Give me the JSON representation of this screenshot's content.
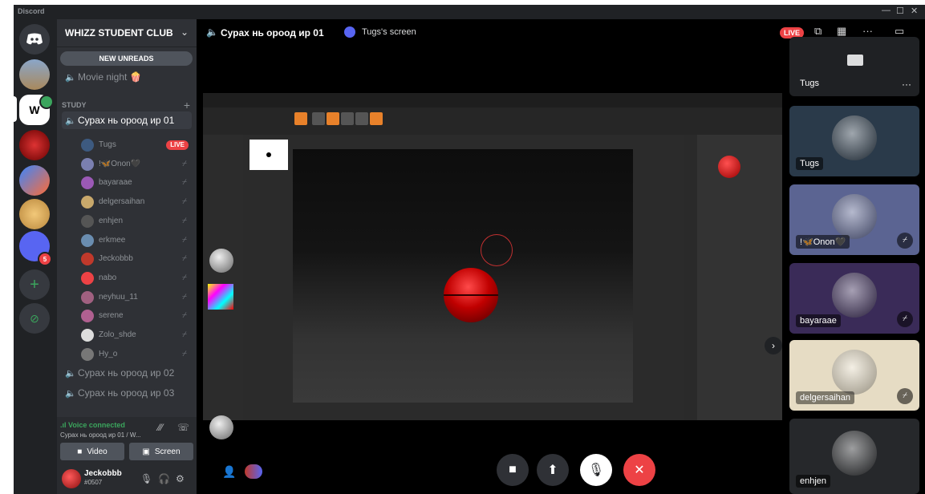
{
  "window": {
    "app_name": "Discord",
    "minimize": "—",
    "maximize": "☐",
    "close": "✕"
  },
  "servers": [
    {
      "name": "discord-home",
      "label": "🎮"
    },
    {
      "name": "server-temple",
      "label": ""
    },
    {
      "name": "server-whizz",
      "label": "W",
      "badge": ""
    },
    {
      "name": "server-demon",
      "label": ""
    },
    {
      "name": "server-unity",
      "label": "",
      "badge": ""
    },
    {
      "name": "server-doge",
      "label": ""
    },
    {
      "name": "server-folder",
      "label": "",
      "badge": "5"
    }
  ],
  "server_header": {
    "name": "WHIZZ STUDENT CLUB"
  },
  "sidebar": {
    "new_unreads": "NEW UNREADS",
    "movie_night": "Movie night 🍿",
    "category": "STUDY",
    "active_channel": "Сурах нь ороод ир 01",
    "voice_users": [
      {
        "name": "Tugs",
        "live": "LIVE",
        "color": "#3d5a80"
      },
      {
        "name": "!🦋Onon🖤",
        "color": "#7a7fb0"
      },
      {
        "name": "bayaraae",
        "color": "#9b59b6"
      },
      {
        "name": "delgersaihan",
        "color": "#c8a86b"
      },
      {
        "name": "enhjen",
        "color": "#555"
      },
      {
        "name": "erkmee",
        "color": "#6a8db0"
      },
      {
        "name": "Jeckobbb",
        "color": "#c0392b"
      },
      {
        "name": "nabo",
        "color": "#ed4245"
      },
      {
        "name": "neyhuu_11",
        "color": "#a06080"
      },
      {
        "name": "serene",
        "color": "#b06090"
      },
      {
        "name": "Zolo_shde",
        "color": "#ddd"
      },
      {
        "name": "Hy_o",
        "color": "#777"
      }
    ],
    "other_channels": [
      "Сурах нь ороод ир 02",
      "Сурах нь ороод ир 03"
    ]
  },
  "voice_panel": {
    "status": ".ıl Voice connected",
    "channel": "Сурах нь ороод ир 01 / W...",
    "video_label": "Video",
    "screen_label": "Screen"
  },
  "user_panel": {
    "username": "Jeckobbb",
    "tag": "#0507"
  },
  "topbar": {
    "channel": "Сурах нь ороод ир 01",
    "screen": "Tugs's screen",
    "live": "LIVE",
    "more": "···"
  },
  "tiles": [
    {
      "name": "Tugs",
      "muted": false,
      "bg": "#1f2124"
    },
    {
      "name": "Tugs",
      "muted": false,
      "bg": "#2a3a4a"
    },
    {
      "name": "!🦋Onon🖤",
      "muted": true,
      "bg": "#5b6492"
    },
    {
      "name": "bayaraae",
      "muted": true,
      "bg": "#3a2b58"
    },
    {
      "name": "delgersaihan",
      "muted": true,
      "bg": "#e6dcc4"
    },
    {
      "name": "enhjen",
      "muted": false,
      "bg": "#26282b"
    }
  ],
  "colors": {
    "live_red": "#ed4245",
    "voice_green": "#3ba55d",
    "blurple": "#5865f2",
    "zbrush_orange": "#e8812a"
  }
}
